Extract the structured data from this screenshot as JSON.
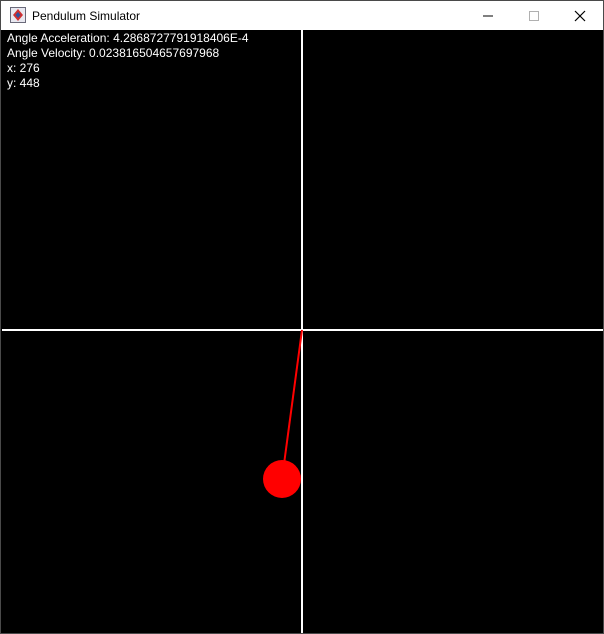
{
  "window": {
    "title": "Pendulum Simulator",
    "controls": {
      "minimize": "minimize-icon",
      "maximize": "maximize-icon",
      "close": "close-icon"
    }
  },
  "readouts": {
    "angle_acceleration": "Angle Acceleration: 4.2868727791918406E-4",
    "angle_velocity": "Angle Velocity: 0.023816504657697968",
    "x": "x: 276",
    "y": "y: 448"
  },
  "pendulum": {
    "rod_color": "#ff0000",
    "bob_color": "#ff0000",
    "axis_color": "#ffffff",
    "background": "#000000"
  }
}
